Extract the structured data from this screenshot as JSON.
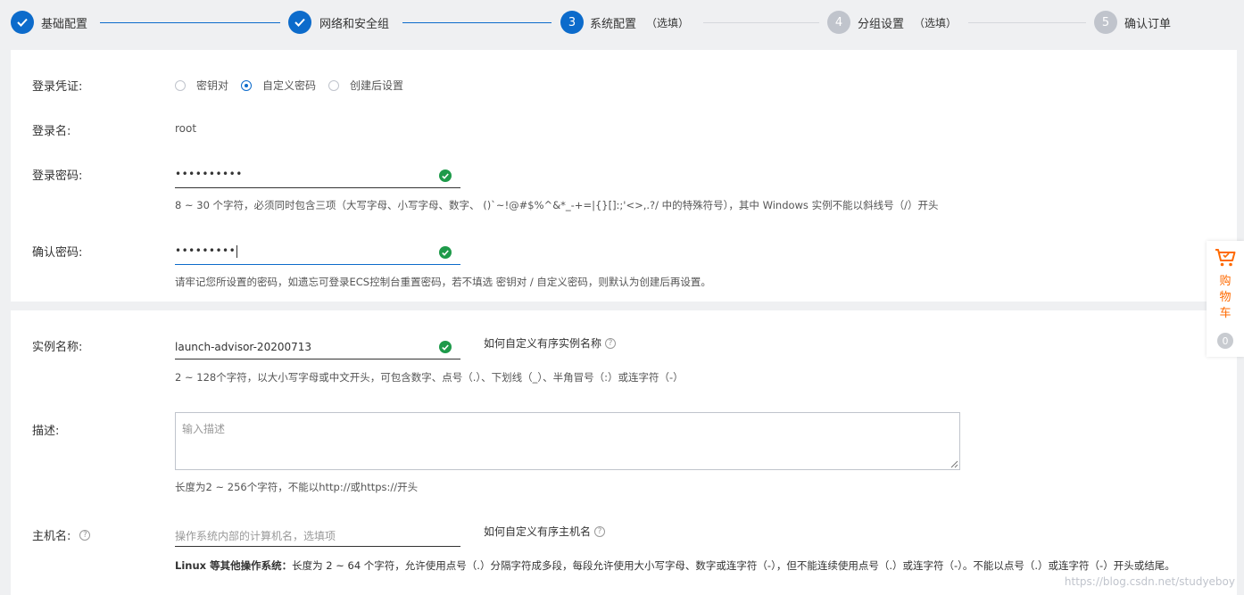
{
  "steps": [
    {
      "label": "基础配置",
      "num": "",
      "optional": ""
    },
    {
      "label": "网络和安全组",
      "num": "",
      "optional": ""
    },
    {
      "label": "系统配置",
      "num": "3",
      "optional": "（选填）"
    },
    {
      "label": "分组设置",
      "num": "4",
      "optional": "（选填）"
    },
    {
      "label": "确认订单",
      "num": "5",
      "optional": ""
    }
  ],
  "login": {
    "credential_label": "登录凭证:",
    "credential_options": [
      "密钥对",
      "自定义密码",
      "创建后设置"
    ],
    "credential_selected": "自定义密码",
    "username_label": "登录名:",
    "username_value": "root",
    "password_label": "登录密码:",
    "password_value": "••••••••••",
    "password_hint": "8 ~ 30 个字符，必须同时包含三项（大写字母、小写字母、数字、 ()`~!@#$%^&*_-+=|{}[]:;'<>,.?/ 中的特殊符号），其中 Windows 实例不能以斜线号（/）开头",
    "confirm_label": "确认密码:",
    "confirm_value": "•••••••••",
    "confirm_hint": "请牢记您所设置的密码，如遗忘可登录ECS控制台重置密码，若不填选 密钥对 / 自定义密码，则默认为创建后再设置。"
  },
  "instance": {
    "name_label": "实例名称:",
    "name_value": "launch-advisor-20200713",
    "name_help": "如何自定义有序实例名称",
    "name_hint": "2 ~ 128个字符，以大小写字母或中文开头，可包含数字、点号（.）、下划线（_）、半角冒号（:）或连字符（-）",
    "desc_label": "描述:",
    "desc_placeholder": "输入描述",
    "desc_hint": "长度为2 ~ 256个字符，不能以http://或https://开头",
    "host_label": "主机名:",
    "host_placeholder": "操作系统内部的计算机名，选填项",
    "host_help": "如何自定义有序主机名",
    "host_hint_bold": "Linux 等其他操作系统：",
    "host_hint": "长度为 2 ~ 64 个字符，允许使用点号（.）分隔字符成多段，每段允许使用大小写字母、数字或连字符（-），但不能连续使用点号（.）或连字符（-）。不能以点号（.）或连字符（-）开头或结尾。"
  },
  "cart": {
    "label": "购物车",
    "chars": [
      "购",
      "物",
      "车"
    ],
    "count": "0"
  },
  "watermark": "https://blog.csdn.net/studyeboy",
  "colors": {
    "accent": "#0c6bcb",
    "success": "#1e9a4a",
    "cart": "#ff6a00"
  }
}
